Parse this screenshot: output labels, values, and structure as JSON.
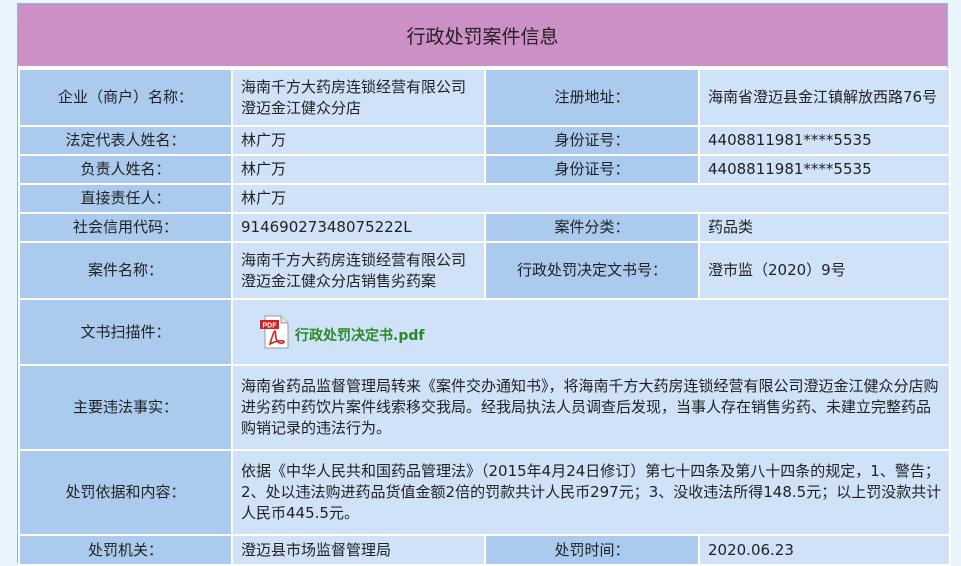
{
  "title": "行政处罚案件信息",
  "fields": {
    "company_name_label": "企业（商户）名称：",
    "company_name": "海南千方大药房连锁经营有限公司澄迈金江健众分店",
    "address_label": "注册地址：",
    "address": "海南省澄迈县金江镇解放西路76号",
    "legal_rep_label": "法定代表人姓名：",
    "legal_rep": "林广万",
    "id_label_1": "身份证号：",
    "id_1": "4408811981****5535",
    "person_in_charge_label": "负责人姓名：",
    "person_in_charge": "林广万",
    "id_label_2": "身份证号：",
    "id_2": "4408811981****5535",
    "direct_responsible_label": "直接责任人：",
    "direct_responsible": "林广万",
    "credit_code_label": "社会信用代码：",
    "credit_code": "91469027348075222L",
    "case_category_label": "案件分类：",
    "case_category": "药品类",
    "case_name_label": "案件名称：",
    "case_name": "海南千方大药房连锁经营有限公司澄迈金江健众分店销售劣药案",
    "decision_no_label": "行政处罚决定文书号：",
    "decision_no": "澄市监（2020）9号",
    "scan_label": "文书扫描件：",
    "scan_file": "行政处罚决定书.pdf",
    "facts_label": "主要违法事实：",
    "facts": "海南省药品监督管理局转来《案件交办通知书》，将海南千方大药房连锁经营有限公司澄迈金江健众分店购进劣药中药饮片案件线索移交我局。经我局执法人员调查后发现，当事人存在销售劣药、未建立完整药品购销记录的违法行为。",
    "basis_label": "处罚依据和内容：",
    "basis": "依据《中华人民共和国药品管理法》（2015年4月24日修订）第七十四条及第八十四条的规定，1、警告；2、处以违法购进药品货值金额2倍的罚款共计人民币297元；3、没收违法所得148.5元；以上罚没款共计人民币445.5元。",
    "authority_label": "处罚机关：",
    "authority": "澄迈县市场监督管理局",
    "time_label": "处罚时间：",
    "time": "2020.06.23"
  }
}
